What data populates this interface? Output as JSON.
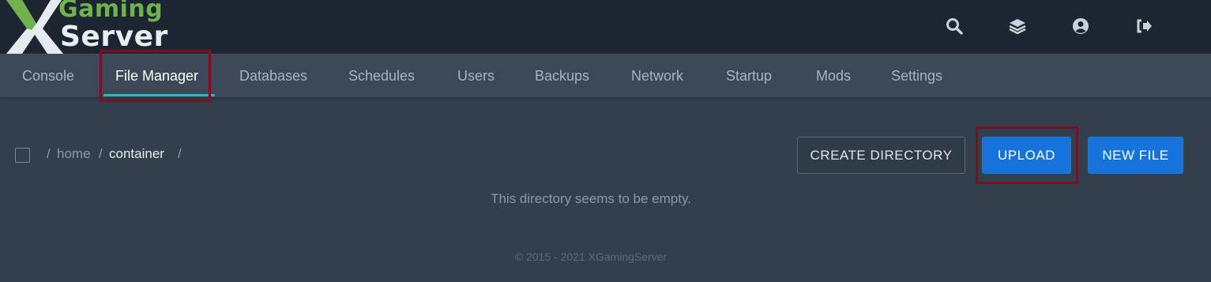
{
  "brand": {
    "line1": "Gaming",
    "line2": "Server",
    "logo_mark": "X-logo-icon"
  },
  "topbar": {
    "icons": [
      {
        "name": "search-icon"
      },
      {
        "name": "layers-icon"
      },
      {
        "name": "user-circle-icon"
      },
      {
        "name": "sign-out-icon"
      }
    ]
  },
  "nav": {
    "items": [
      {
        "label": "Console"
      },
      {
        "label": "File Manager",
        "active": true
      },
      {
        "label": "Databases"
      },
      {
        "label": "Schedules"
      },
      {
        "label": "Users"
      },
      {
        "label": "Backups"
      },
      {
        "label": "Network"
      },
      {
        "label": "Startup"
      },
      {
        "label": "Mods"
      },
      {
        "label": "Settings"
      }
    ]
  },
  "breadcrumb": {
    "sep": "/",
    "parts": [
      "home",
      "container"
    ]
  },
  "actions": {
    "create_directory": "CREATE DIRECTORY",
    "upload": "UPLOAD",
    "new_file": "NEW FILE"
  },
  "empty_message": "This directory seems to be empty.",
  "footer": "© 2015 - 2021 XGamingServer",
  "colors": {
    "accent_green": "#6fb24e",
    "primary_blue": "#1573d9",
    "tab_underline": "#2fb6c1",
    "highlight_red": "#7a1120"
  }
}
